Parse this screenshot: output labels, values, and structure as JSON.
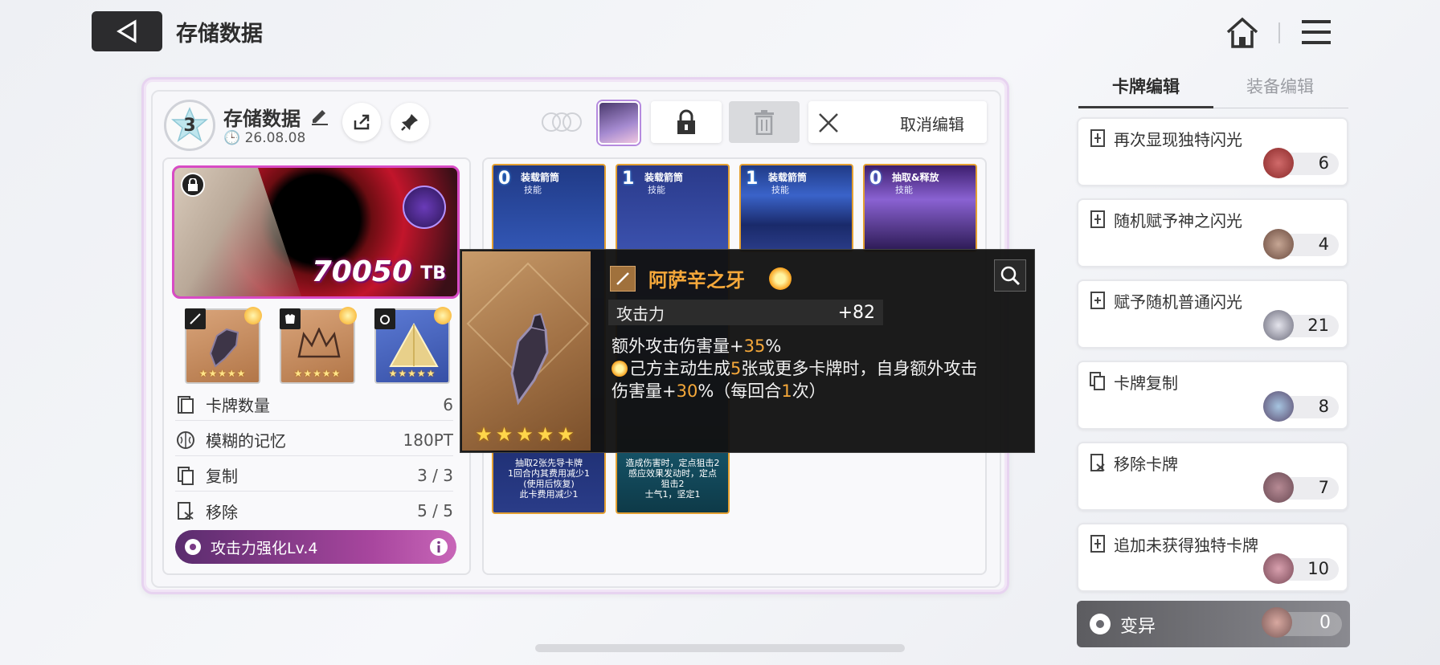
{
  "header": {
    "title": "存储数据"
  },
  "save": {
    "level": "3",
    "name": "存储数据",
    "date": "26.08.08",
    "cancel_label": "取消编辑"
  },
  "character": {
    "score": "70050",
    "unit": "TB"
  },
  "equipment": [
    {
      "name": "gauntlet",
      "stars": "★★★★★",
      "bg": "#c98a5a"
    },
    {
      "name": "crown",
      "stars": "★★★★★",
      "bg": "#c98a5a"
    },
    {
      "name": "pyramid",
      "stars": "★★★★★",
      "bg": "#4c66c2"
    }
  ],
  "stats": [
    {
      "label": "卡牌数量",
      "value": "6"
    },
    {
      "label": "模糊的记忆",
      "value": "180PT"
    },
    {
      "label": "复制",
      "value": "3 / 3"
    },
    {
      "label": "移除",
      "value": "5 / 5"
    }
  ],
  "buff": {
    "label": "攻击力强化Lv.4"
  },
  "cards": [
    {
      "cost": "0",
      "name": "装载箭筒",
      "type": "技能",
      "desc_1": "抽取2张先导卡牌",
      "desc_2": "1回合内其费用减少1",
      "desc_3": "(使用后恢复)",
      "desc_4": "此卡费用减少1"
    },
    {
      "cost": "1",
      "name": "装载箭筒",
      "type": "技能",
      "desc_1": "造成伤害时，定点狙击2",
      "desc_2": "感应效果发动时，定点",
      "desc_3": "狙击2",
      "desc_4": "士气1，坚定1"
    },
    {
      "cost": "1",
      "name": "装载箭筒",
      "type": "技能"
    },
    {
      "cost": "0",
      "name": "抽取&释放",
      "type": "技能"
    }
  ],
  "tooltip": {
    "title": "阿萨辛之牙",
    "stat_label": "攻击力",
    "stat_value": "+82",
    "line1_pre": "额外攻击伤害量+",
    "line1_num": "35",
    "line1_post": "%",
    "line2_pre": "己方主动生成",
    "line2_num": "5",
    "line2_post": "张或更多卡牌时，自身额外攻击",
    "line3_pre": "伤害量+",
    "line3_num": "30",
    "line3_mid": "%（每回合",
    "line3_num2": "1",
    "line3_post": "次）",
    "stars": "★★★★★",
    "accent": "#f5a83a"
  },
  "tabs": {
    "active": "卡牌编辑",
    "inactive": "装备编辑"
  },
  "skills": [
    {
      "label": "再次显现独特闪光",
      "count": "6",
      "orb": "#8a2a2a"
    },
    {
      "label": "随机赋予神之闪光",
      "count": "4",
      "orb": "#6a4a3e"
    },
    {
      "label": "赋予随机普通闪光",
      "count": "21",
      "orb": "#7a7a8a"
    },
    {
      "label": "卡牌复制",
      "count": "8",
      "orb": "#5a4a6e"
    },
    {
      "label": "移除卡牌",
      "count": "7",
      "orb": "#6a4a54"
    },
    {
      "label": "追加未获得独特卡牌",
      "count": "10",
      "orb": "#7a4a58"
    }
  ],
  "mutation": {
    "label": "变异",
    "count": "0"
  }
}
